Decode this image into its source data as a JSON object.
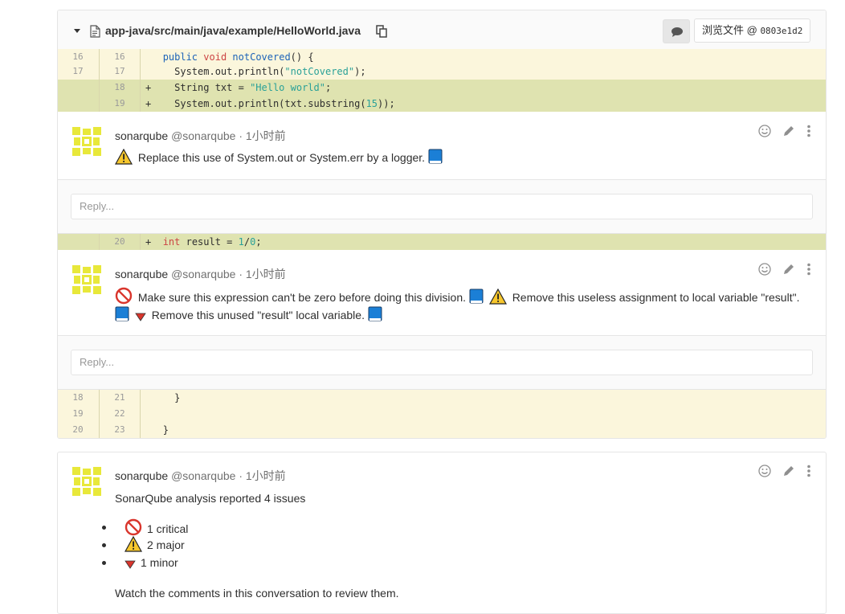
{
  "file": {
    "path": "app-java/src/main/java/example/HelloWorld.java",
    "view_file_label": "浏览文件 @",
    "commit_sha": "0803e1d2"
  },
  "diff": {
    "top_lines": [
      {
        "old": "16",
        "new": "16",
        "sign": "",
        "type": "context"
      },
      {
        "old": "17",
        "new": "17",
        "sign": "",
        "type": "context"
      },
      {
        "old": "",
        "new": "18",
        "sign": "+",
        "type": "added"
      },
      {
        "old": "",
        "new": "19",
        "sign": "+",
        "type": "added"
      }
    ],
    "line_20": {
      "old": "",
      "new": "20",
      "sign": "+"
    },
    "bottom_lines": [
      {
        "old": "18",
        "new": "21",
        "text": "  }"
      },
      {
        "old": "19",
        "new": "22",
        "text": ""
      },
      {
        "old": "20",
        "new": "23",
        "text": "}"
      }
    ],
    "code": {
      "l16_public": "public",
      "l16_void": "void",
      "l16_name": "notCovered",
      "l16_rest": "() {",
      "l17_pre": "  System.out.println(",
      "l17_str": "\"notCovered\"",
      "l17_post": ");",
      "l18_pre": "  String txt = ",
      "l18_str": "\"Hello world\"",
      "l18_post": ";",
      "l19_pre": "  System.out.println(txt.substring(",
      "l19_num": "15",
      "l19_post": "));",
      "l20_int": "int",
      "l20_mid": " result = ",
      "l20_num": "1",
      "l20_slash": "/",
      "l20_zero": "0",
      "l20_end": ";"
    }
  },
  "notes": [
    {
      "author": "sonarqube",
      "handle": "@sonarqube",
      "time": "· 1小时前",
      "text1": "Replace this use of System.out or System.err by a logger."
    },
    {
      "author": "sonarqube",
      "handle": "@sonarqube",
      "time": "· 1小时前",
      "text1": "Make sure this expression can't be zero before doing this division.",
      "text2": "Remove this useless assignment to local variable \"result\".",
      "text3": "Remove this unused \"result\" local variable."
    },
    {
      "author": "sonarqube",
      "handle": "@sonarqube",
      "time": "· 1小时前",
      "intro": "SonarQube analysis reported 4 issues",
      "items": [
        "1 critical",
        "2 major",
        "1 minor"
      ],
      "outro": "Watch the comments in this conversation to review them."
    }
  ],
  "reply_placeholder": "Reply...",
  "icons": {
    "file": "file-icon",
    "copy": "copy-icon",
    "comment": "comment-icon",
    "smiley": "smiley-icon",
    "pencil": "pencil-icon",
    "more": "more-vertical-icon",
    "warning": "warning-icon",
    "blocker": "blocked-icon",
    "minor": "triangle-down-icon",
    "book": "book-icon"
  },
  "colors": {
    "added_bg": "#dfe3b0",
    "context_bg": "#fbf6dc",
    "warning": "#f7c72d",
    "critical": "#d9352c",
    "book": "#1b7fd6"
  }
}
